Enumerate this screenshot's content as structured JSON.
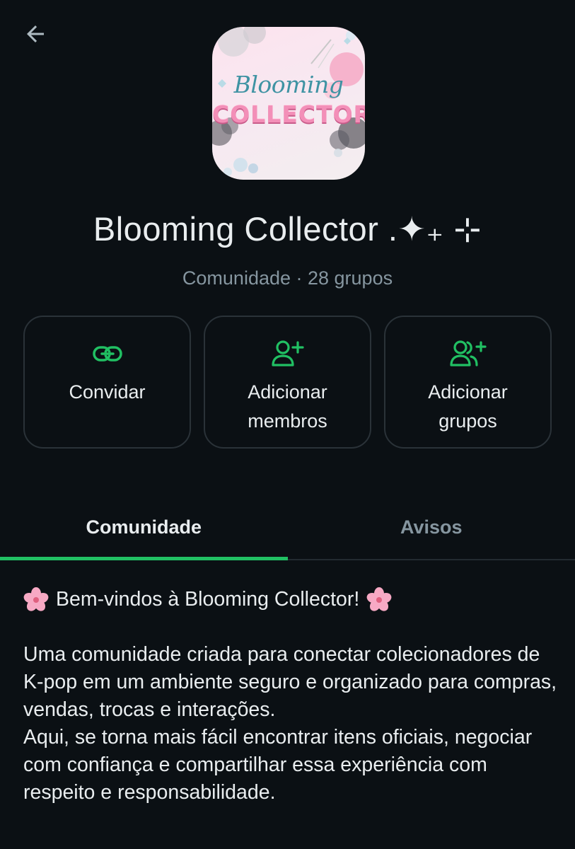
{
  "header": {
    "back_icon": "arrow-left-icon"
  },
  "community": {
    "avatar": {
      "logo_line1": "Blooming",
      "logo_line2": "COLLECTOR"
    },
    "name": "Blooming Collector .✦₊ ⊹",
    "subtitle": "Comunidade · 28 grupos"
  },
  "actions": [
    {
      "icon": "link-icon",
      "label": "Convidar"
    },
    {
      "icon": "add-person-icon",
      "label": "Adicionar\nmembros"
    },
    {
      "icon": "add-group-icon",
      "label": "Adicionar\ngrupos"
    }
  ],
  "tabs": [
    {
      "label": "Comunidade",
      "active": true
    },
    {
      "label": "Avisos",
      "active": false
    }
  ],
  "description": {
    "welcome": "Bem-vindos à Blooming Collector!",
    "welcome_icon": "cherry-blossom-icon",
    "paragraph1": "Uma comunidade criada para conectar colecionadores de K-pop em um ambiente seguro e organizado para compras, vendas, trocas e interações.",
    "paragraph2": "Aqui, se torna mais fácil encontrar itens oficiais, negociar com confiança e compartilhar essa experiência com respeito e responsabilidade."
  },
  "colors": {
    "background": "#0b1014",
    "accent": "#21c063",
    "text_primary": "#e9edef",
    "text_secondary": "#8696a0",
    "card_border": "#2a3238"
  }
}
